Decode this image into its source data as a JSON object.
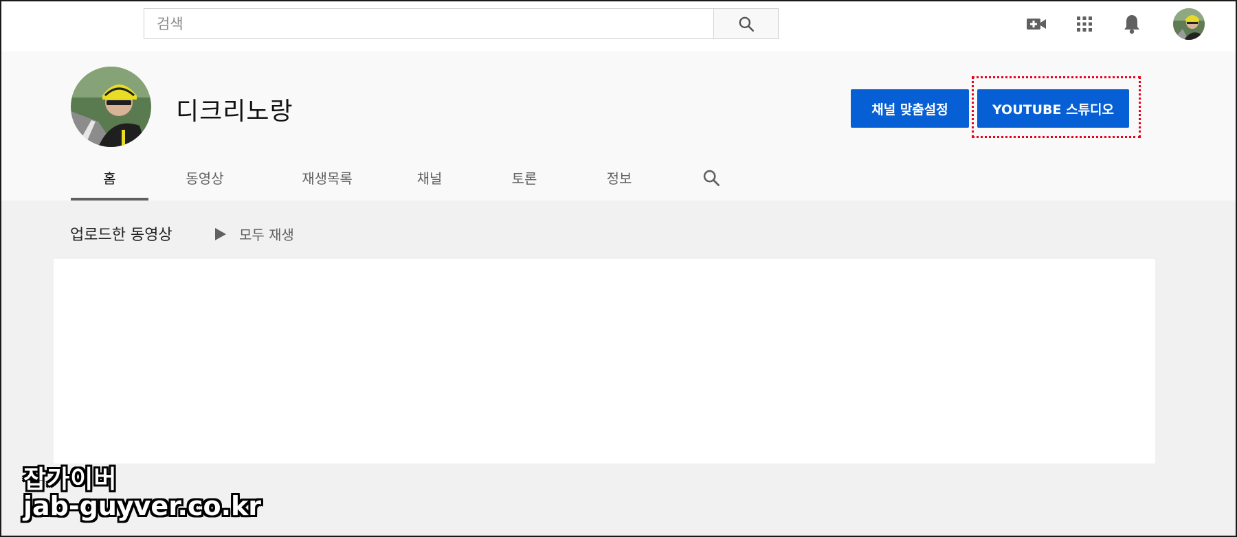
{
  "search": {
    "placeholder": "검색"
  },
  "channel": {
    "name": "디크리노랑"
  },
  "buttons": {
    "customize": "채널 맞춤설정",
    "studio": "YOUTUBE 스튜디오"
  },
  "tabs": [
    {
      "label": "홈",
      "active": true
    },
    {
      "label": "동영상"
    },
    {
      "label": "재생목록"
    },
    {
      "label": "채널"
    },
    {
      "label": "토론"
    },
    {
      "label": "정보"
    }
  ],
  "uploads": {
    "title": "업로드한 동영상",
    "play_all": "모두 재생"
  },
  "watermark": {
    "line1": "잡가이버",
    "line2": "jab-guyver.co.kr"
  },
  "colors": {
    "accent": "#065fd4",
    "highlight": "#e8001c"
  },
  "icons": [
    "search-icon",
    "video-camera-add-icon",
    "apps-grid-icon",
    "bell-icon",
    "play-icon"
  ]
}
